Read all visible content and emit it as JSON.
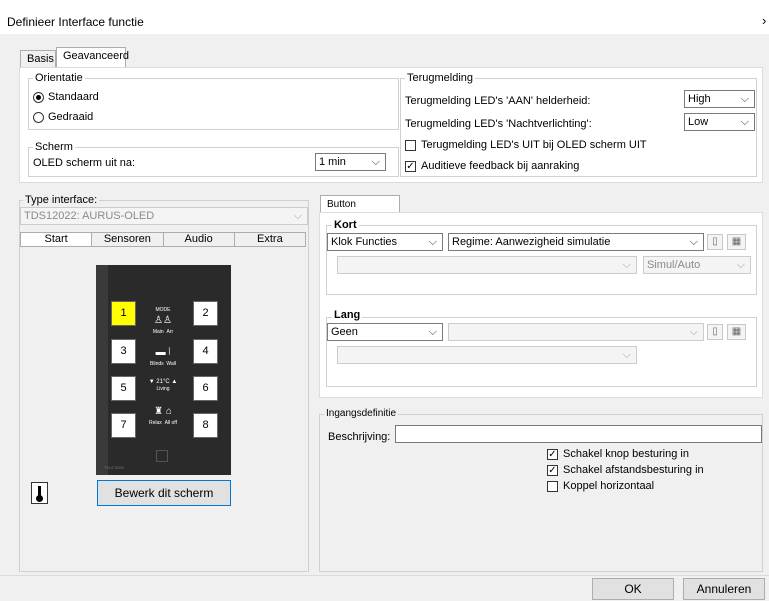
{
  "window": {
    "title": "Definieer Interface functie",
    "close_chevron": "›"
  },
  "top_tabs": [
    {
      "label": "Basis"
    },
    {
      "label": "Geavanceerd"
    }
  ],
  "orientation": {
    "legend": "Orientatie",
    "options": [
      {
        "label": "Standaard",
        "selected": true
      },
      {
        "label": "Gedraaid",
        "selected": false
      }
    ]
  },
  "screen": {
    "legend": "Scherm",
    "oled_label": "OLED scherm uit na:",
    "oled_value": "1 min"
  },
  "feedback": {
    "legend": "Terugmelding",
    "led_on_label": "Terugmelding LED's 'AAN' helderheid:",
    "led_on_value": "High",
    "led_night_label": "Terugmelding LED's 'Nachtverlichting':",
    "led_night_value": "Low",
    "led_off_label": "Terugmelding LED's UIT bij OLED scherm UIT",
    "led_off_checked": false,
    "audio_label": "Auditieve feedback bij aanraking",
    "audio_checked": true
  },
  "interface": {
    "label": "Type interface:",
    "value": "TDS12022: AURUS-OLED",
    "tabs": [
      {
        "label": "Start"
      },
      {
        "label": "Sensoren"
      },
      {
        "label": "Audio"
      },
      {
        "label": "Extra"
      }
    ],
    "keys": [
      "1",
      "2",
      "3",
      "4",
      "5",
      "6",
      "7",
      "8"
    ],
    "selected_key": "1",
    "device_labels": {
      "mode": "MODE",
      "main": "Main",
      "arr": "Arr",
      "blinds": "Blinds",
      "wall": "Wall",
      "temp": "▼ 21°C ▲",
      "living": "Living",
      "relax": "Relax",
      "alloff": "All off",
      "brand": "TELETASK"
    },
    "edit_button": "Bewerk dit scherm",
    "thermometer_icon": "thermometer-icon"
  },
  "button_functions": {
    "tab": "Button functions",
    "kort": {
      "legend": "Kort",
      "function": "Klok Functies",
      "mode": "Regime: Aanwezigheid simulatie",
      "second": "",
      "sim": "Simul/Auto"
    },
    "lang": {
      "legend": "Lang",
      "function": "Geen",
      "mode": "",
      "second": ""
    }
  },
  "ingang": {
    "legend": "Ingangsdefinitie",
    "beschrijving_label": "Beschrijving:",
    "beschrijving_value": "",
    "checks": [
      {
        "label": "Schakel knop besturing in",
        "checked": true
      },
      {
        "label": "Schakel afstandsbesturing in",
        "checked": true
      },
      {
        "label": "Koppel horizontaal",
        "checked": false
      }
    ]
  },
  "footer": {
    "ok": "OK",
    "cancel": "Annuleren"
  },
  "colors": {
    "selected_key": "#ffff00",
    "device": "#2a2a2a"
  }
}
